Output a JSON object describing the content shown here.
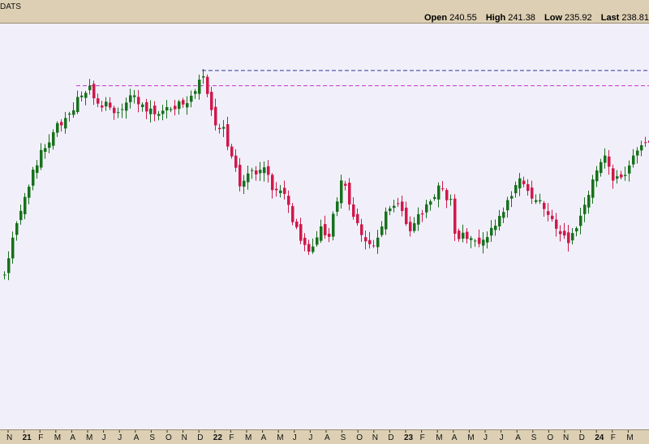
{
  "header": {
    "ticker": "DATS",
    "open_label": "Open",
    "open_value": "240.55",
    "high_label": "High",
    "high_value": "241.38",
    "low_label": "Low",
    "low_value": "235.92",
    "last_label": "Last",
    "last_value": "238.81"
  },
  "colors": {
    "up": "#17701c",
    "down": "#d0184b",
    "background": "#f1f0fa",
    "frame": "#dccfb3",
    "line_high_2021": "#cc33cc",
    "line_high_2021_nov": "#333399"
  },
  "chart_data": {
    "type": "candlestick",
    "title": "",
    "xlabel": "",
    "ylabel": "",
    "grid": false,
    "ylim": [
      120,
      255
    ],
    "x_ticks": [
      "N",
      "21",
      "F",
      "M",
      "A",
      "M",
      "J",
      "J",
      "A",
      "S",
      "O",
      "N",
      "D",
      "22",
      "F",
      "M",
      "A",
      "M",
      "J",
      "J",
      "A",
      "S",
      "O",
      "N",
      "D",
      "23",
      "F",
      "M",
      "A",
      "M",
      "J",
      "J",
      "A",
      "S",
      "O",
      "N",
      "D",
      "24",
      "F",
      "M"
    ],
    "year_ticks": [
      "21",
      "22",
      "23",
      "24"
    ],
    "horizontal_lines": [
      {
        "name": "resistance-2021-peak",
        "y": 237.5,
        "style": "dashed",
        "color": "#cc33cc"
      },
      {
        "name": "resistance-2021-nov-high",
        "y": 246.5,
        "style": "dashed",
        "color": "#333399"
      }
    ],
    "anchors": [
      {
        "t": 0,
        "v": 128
      },
      {
        "t": 1,
        "v": 135
      },
      {
        "t": 3,
        "v": 158
      },
      {
        "t": 6,
        "v": 180
      },
      {
        "t": 9,
        "v": 198
      },
      {
        "t": 13,
        "v": 214
      },
      {
        "t": 16,
        "v": 221
      },
      {
        "t": 19,
        "v": 234
      },
      {
        "t": 21,
        "v": 237
      },
      {
        "t": 23,
        "v": 226
      },
      {
        "t": 25,
        "v": 228
      },
      {
        "t": 28,
        "v": 220
      },
      {
        "t": 31,
        "v": 232
      },
      {
        "t": 33,
        "v": 227
      },
      {
        "t": 36,
        "v": 223
      },
      {
        "t": 38,
        "v": 220
      },
      {
        "t": 41,
        "v": 224
      },
      {
        "t": 45,
        "v": 228
      },
      {
        "t": 48,
        "v": 240
      },
      {
        "t": 49,
        "v": 244
      },
      {
        "t": 50,
        "v": 235
      },
      {
        "t": 52,
        "v": 215
      },
      {
        "t": 54,
        "v": 212
      },
      {
        "t": 56,
        "v": 196
      },
      {
        "t": 58,
        "v": 180
      },
      {
        "t": 61,
        "v": 186
      },
      {
        "t": 64,
        "v": 190
      },
      {
        "t": 66,
        "v": 176
      },
      {
        "t": 69,
        "v": 175
      },
      {
        "t": 72,
        "v": 152
      },
      {
        "t": 75,
        "v": 140
      },
      {
        "t": 78,
        "v": 153
      },
      {
        "t": 80,
        "v": 148
      },
      {
        "t": 83,
        "v": 184
      },
      {
        "t": 86,
        "v": 162
      },
      {
        "t": 89,
        "v": 146
      },
      {
        "t": 91,
        "v": 143
      },
      {
        "t": 94,
        "v": 162
      },
      {
        "t": 97,
        "v": 166
      },
      {
        "t": 100,
        "v": 154
      },
      {
        "t": 102,
        "v": 160
      },
      {
        "t": 105,
        "v": 168
      },
      {
        "t": 107,
        "v": 178
      },
      {
        "t": 110,
        "v": 170
      },
      {
        "t": 111,
        "v": 149
      },
      {
        "t": 114,
        "v": 150
      },
      {
        "t": 117,
        "v": 147
      },
      {
        "t": 120,
        "v": 152
      },
      {
        "t": 122,
        "v": 162
      },
      {
        "t": 124,
        "v": 168
      },
      {
        "t": 127,
        "v": 182
      },
      {
        "t": 130,
        "v": 172
      },
      {
        "t": 133,
        "v": 166
      },
      {
        "t": 136,
        "v": 152
      },
      {
        "t": 139,
        "v": 146
      },
      {
        "t": 141,
        "v": 152
      },
      {
        "t": 143,
        "v": 166
      },
      {
        "t": 146,
        "v": 188
      },
      {
        "t": 148,
        "v": 196
      },
      {
        "t": 150,
        "v": 180
      },
      {
        "t": 153,
        "v": 186
      },
      {
        "t": 155,
        "v": 196
      },
      {
        "t": 158,
        "v": 205
      },
      {
        "t": 159,
        "v": 202
      }
    ]
  }
}
